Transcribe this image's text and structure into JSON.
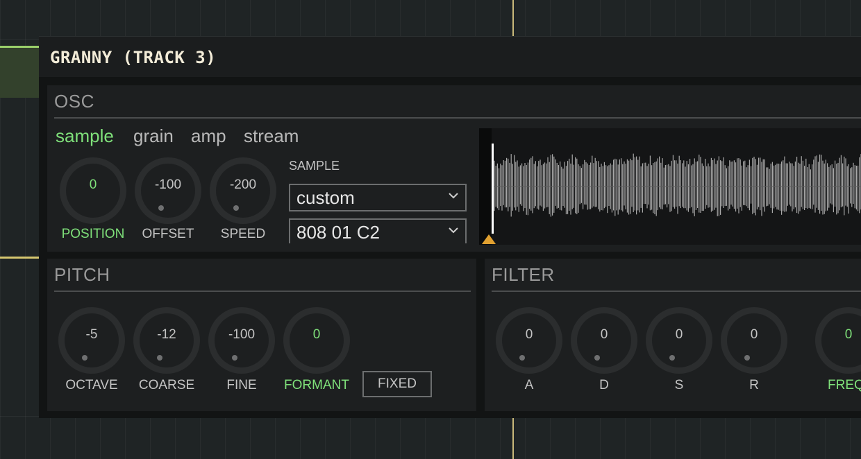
{
  "window": {
    "title": "GRANNY (TRACK 3)"
  },
  "osc": {
    "title": "OSC",
    "tabs": [
      "sample",
      "grain",
      "amp",
      "stream"
    ],
    "active_tab": "sample",
    "knobs": [
      {
        "label": "POSITION",
        "value": "0",
        "active": true
      },
      {
        "label": "OFFSET",
        "value": "-100",
        "active": false
      },
      {
        "label": "SPEED",
        "value": "-200",
        "active": false
      }
    ],
    "sample_label": "SAMPLE",
    "sample_source": "custom",
    "sample_name": "808 01 C2"
  },
  "pitch": {
    "title": "PITCH",
    "knobs": [
      {
        "label": "OCTAVE",
        "value": "-5",
        "active": false
      },
      {
        "label": "COARSE",
        "value": "-12",
        "active": false
      },
      {
        "label": "FINE",
        "value": "-100",
        "active": false
      },
      {
        "label": "FORMANT",
        "value": "0",
        "active": true
      }
    ],
    "fixed_button": "FIXED"
  },
  "filter": {
    "title": "FILTER",
    "knobs": [
      {
        "label": "A",
        "value": "0",
        "active": false
      },
      {
        "label": "D",
        "value": "0",
        "active": false
      },
      {
        "label": "S",
        "value": "0",
        "active": false
      },
      {
        "label": "R",
        "value": "0",
        "active": false
      },
      {
        "label": "FREQ",
        "value": "0",
        "active": true
      }
    ]
  },
  "colors": {
    "accent_green": "#7fe07a",
    "playhead": "#c9b97a",
    "waveform": "#a8a8a8",
    "marker": "#e0a030"
  }
}
